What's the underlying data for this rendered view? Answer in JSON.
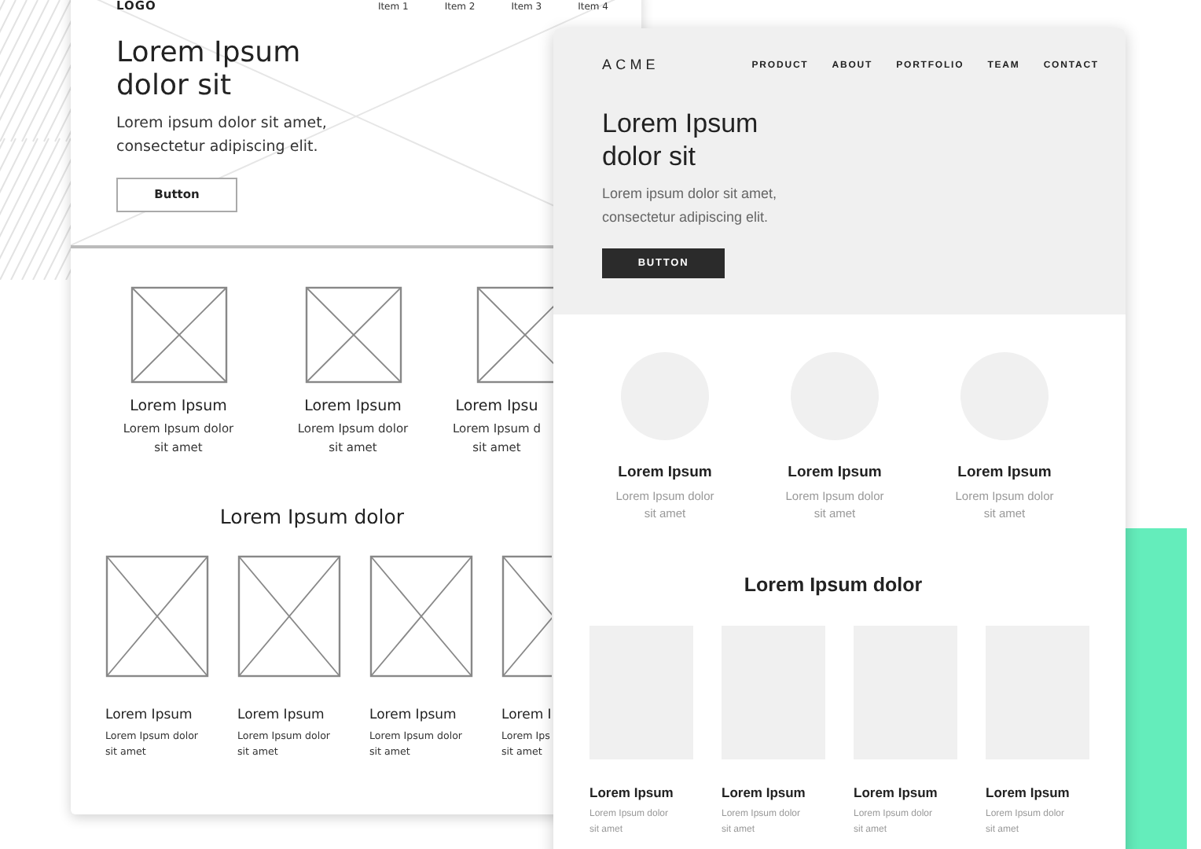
{
  "wireframe": {
    "logo": "LOGO",
    "nav": [
      "Item 1",
      "Item 2",
      "Item 3",
      "Item 4"
    ],
    "hero": {
      "title": "Lorem Ipsum dolor sit",
      "text": "Lorem ipsum dolor sit amet, consectetur adipiscing elit.",
      "button": "Button"
    },
    "features": [
      {
        "title": "Lorem Ipsum",
        "lines": [
          "Lorem Ipsum dolor",
          "sit amet"
        ]
      },
      {
        "title": "Lorem Ipsum",
        "lines": [
          "Lorem Ipsum dolor",
          "sit amet"
        ]
      },
      {
        "title": "Lorem Ipsu",
        "lines": [
          "Lorem Ipsum d",
          "sit amet"
        ]
      }
    ],
    "section_title": "Lorem Ipsum dolor",
    "cards": [
      {
        "title": "Lorem Ipsum",
        "lines": [
          "Lorem Ipsum dolor",
          "sit amet"
        ]
      },
      {
        "title": "Lorem Ipsum",
        "lines": [
          "Lorem Ipsum dolor",
          "sit amet"
        ]
      },
      {
        "title": "Lorem Ipsum",
        "lines": [
          "Lorem Ipsum dolor",
          "sit amet"
        ]
      },
      {
        "title": "Lorem I",
        "lines": [
          "Lorem Ips",
          "sit amet"
        ]
      }
    ]
  },
  "mockup": {
    "logo": "ACME",
    "nav": [
      "PRODUCT",
      "ABOUT",
      "PORTFOLIO",
      "TEAM",
      "CONTACT"
    ],
    "hero": {
      "title": "Lorem Ipsum dolor sit",
      "text": "Lorem ipsum dolor sit amet, consectetur adipiscing elit.",
      "button": "BUTTON"
    },
    "features": [
      {
        "title": "Lorem Ipsum",
        "lines": [
          "Lorem Ipsum dolor",
          "sit amet"
        ]
      },
      {
        "title": "Lorem Ipsum",
        "lines": [
          "Lorem Ipsum dolor",
          "sit amet"
        ]
      },
      {
        "title": "Lorem Ipsum",
        "lines": [
          "Lorem Ipsum dolor",
          "sit amet"
        ]
      }
    ],
    "section_title": "Lorem Ipsum dolor",
    "cards": [
      {
        "title": "Lorem Ipsum",
        "lines": [
          "Lorem Ipsum dolor",
          "sit amet"
        ]
      },
      {
        "title": "Lorem Ipsum",
        "lines": [
          "Lorem Ipsum dolor",
          "sit amet"
        ]
      },
      {
        "title": "Lorem Ipsum",
        "lines": [
          "Lorem Ipsum dolor",
          "sit amet"
        ]
      },
      {
        "title": "Lorem Ipsum",
        "lines": [
          "Lorem Ipsum dolor",
          "sit amet"
        ]
      }
    ]
  }
}
